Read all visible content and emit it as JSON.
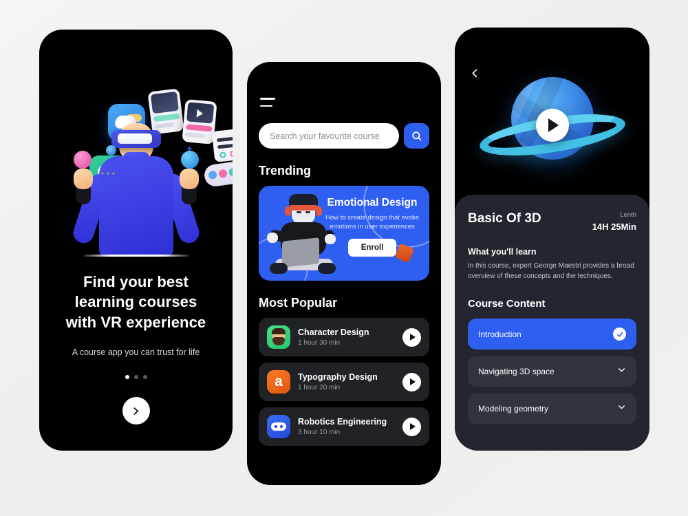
{
  "theme": {
    "accent_blue": "#2f5ff0",
    "background": "#f1f1f0",
    "phone_bg": "#000000",
    "card_dark": "#23262e"
  },
  "screen_onboarding": {
    "title_lines": [
      "Find your best",
      "learning courses",
      "with VR experience"
    ],
    "subtitle": "A course app you can trust for life",
    "pagination": {
      "total": 3,
      "active_index": 0
    },
    "next_label": "next"
  },
  "screen_home": {
    "menu_label": "menu",
    "search": {
      "placeholder": "Search your favourite course",
      "value": "",
      "button_label": "search"
    },
    "trending": {
      "heading": "Trending",
      "card": {
        "title": "Emotional Design",
        "description": "How to create design that evoke emotions in user experiences",
        "cta": "Enroll"
      }
    },
    "most_popular": {
      "heading": "Most Popular",
      "items": [
        {
          "title": "Character Design",
          "duration": "1 hour 30 min",
          "icon": "avatar-icon",
          "play": "play"
        },
        {
          "title": "Typography Design",
          "duration": "1 hour 20 min",
          "icon": "typography-icon",
          "play": "play"
        },
        {
          "title": "Robotics Engineering",
          "duration": "3 hour 10 min",
          "icon": "robot-icon",
          "play": "play"
        }
      ]
    }
  },
  "screen_course": {
    "back_label": "back",
    "media": {
      "play_label": "play",
      "illustration": "planet-3d"
    },
    "title": "Basic Of 3D",
    "length_label": "Lenth",
    "length_value": "14H 25Min",
    "learn_heading": "What you'll learn",
    "learn_description": "In this course, expert George Maestri provides a broad overview of these concepts and the techniques.",
    "content_heading": "Course Content",
    "lessons": [
      {
        "label": "Introduction",
        "state": "active",
        "indicator": "check-circle-icon"
      },
      {
        "label": "Navigating 3D space",
        "state": "collapsed",
        "indicator": "chevron-down-icon"
      },
      {
        "label": "Modeling geometry",
        "state": "collapsed",
        "indicator": "chevron-down-icon"
      }
    ]
  }
}
